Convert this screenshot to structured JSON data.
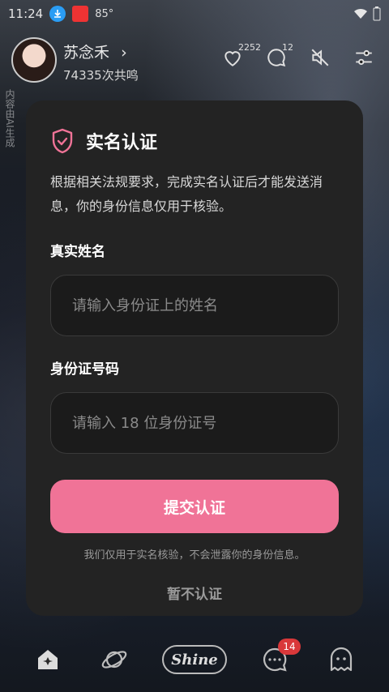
{
  "status_bar": {
    "time": "11:24",
    "temperature": "85°"
  },
  "header": {
    "name": "苏念禾",
    "chevron": "›",
    "subtitle": "74335次共鸣",
    "likes": "2252",
    "comments": "12"
  },
  "side_watermark": "内容由AI生成",
  "dialog": {
    "title": "实名认证",
    "description": "根据相关法规要求，完成实名认证后才能发送消息，你的身份信息仅用于核验。",
    "name_label": "真实姓名",
    "name_placeholder": "请输入身份证上的姓名",
    "id_label": "身份证号码",
    "id_placeholder": "请输入 18 位身份证号",
    "submit": "提交认证",
    "note": "我们仅用于实名核验，不会泄露你的身份信息。",
    "skip": "暂不认证"
  },
  "bottom_nav": {
    "shine_label": "Shine",
    "message_badge": "14"
  },
  "colors": {
    "accent": "#f07397",
    "dialog_bg": "#232323",
    "badge": "#d9383a"
  }
}
